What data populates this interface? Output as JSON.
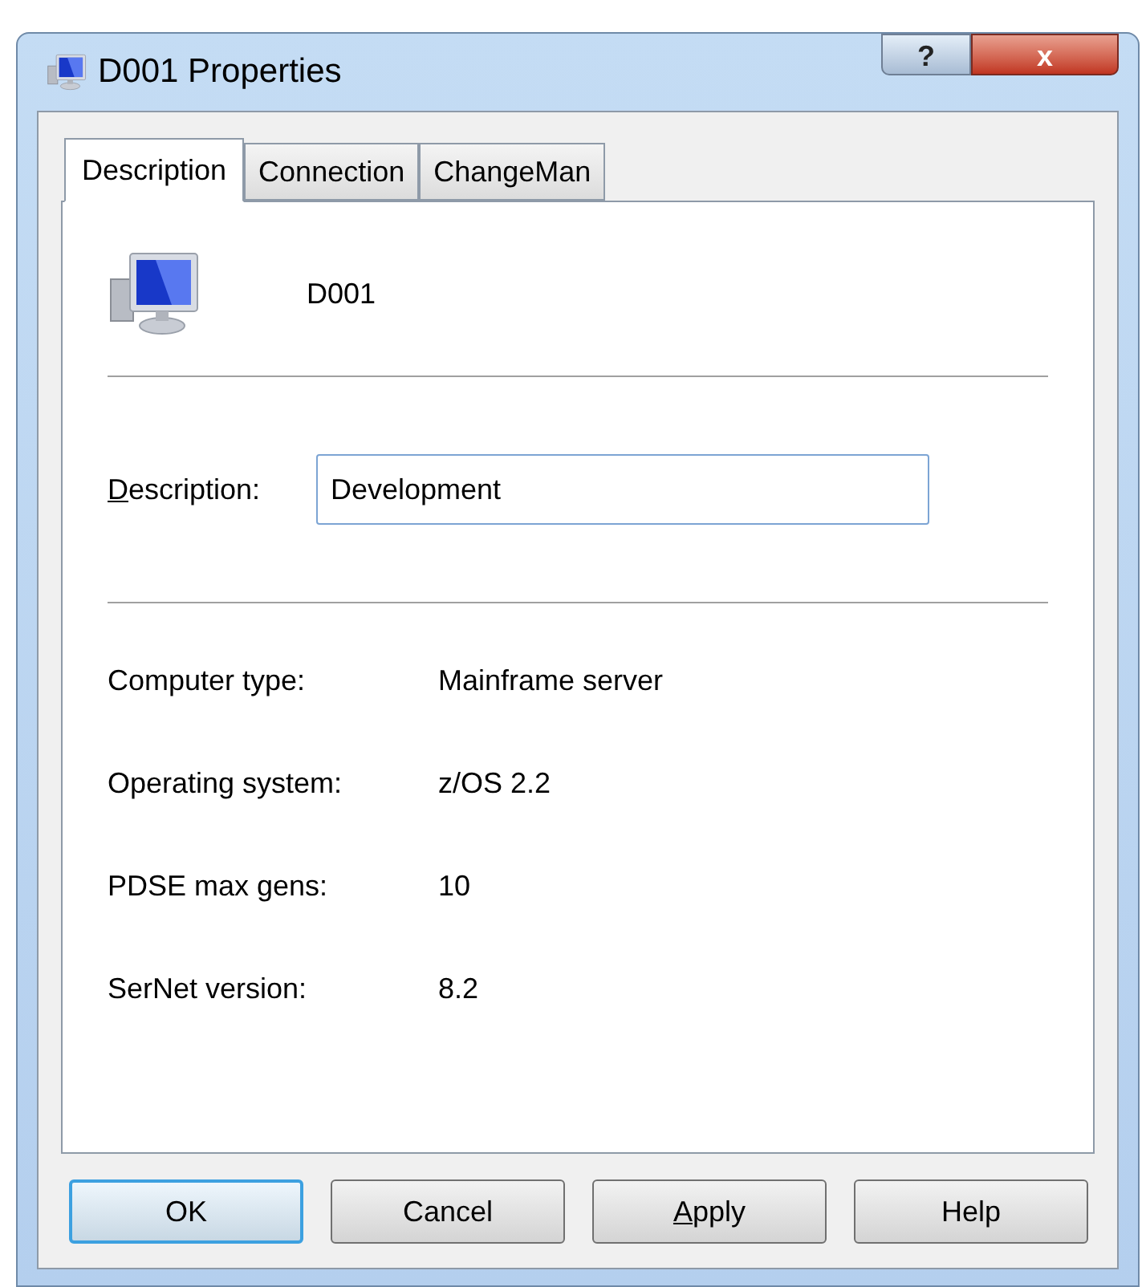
{
  "window": {
    "title": "D001 Properties",
    "help_button": "?",
    "close_button": "x"
  },
  "tabs": [
    {
      "label": "Description",
      "selected": true
    },
    {
      "label": "Connection",
      "selected": false
    },
    {
      "label": "ChangeMan",
      "selected": false
    }
  ],
  "header": {
    "name": "D001"
  },
  "description": {
    "label": "Description:",
    "mnemonic": true,
    "value": "Development"
  },
  "properties": [
    {
      "label": "Computer type:",
      "value": "Mainframe server"
    },
    {
      "label": "Operating system:",
      "value": "z/OS 2.2"
    },
    {
      "label": "PDSE max gens:",
      "value": "10"
    },
    {
      "label": "SerNet version:",
      "value": "8.2"
    }
  ],
  "buttons": [
    {
      "label": "OK",
      "default": true,
      "mnemonic": false
    },
    {
      "label": "Cancel",
      "default": false,
      "mnemonic": false
    },
    {
      "label": "Apply",
      "default": false,
      "mnemonic": true
    },
    {
      "label": "Help",
      "default": false,
      "mnemonic": false
    }
  ]
}
